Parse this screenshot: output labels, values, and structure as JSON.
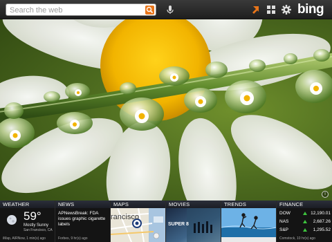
{
  "search": {
    "placeholder": "Search the web"
  },
  "toolbar": {
    "mic_icon": "microphone-icon",
    "location_icon": "location-arrow-icon",
    "grid_icon": "grid-icon",
    "settings_icon": "gear-icon",
    "logo": "bing"
  },
  "colors": {
    "accent": "#e8751a",
    "tile_bg": "#141414",
    "up": "#3ec43e"
  },
  "tiles": {
    "weather": {
      "header": "WEATHER",
      "temp": "59°",
      "condition": "Mostly Sunny",
      "location": "San Francisco, CA",
      "footer": "iMap, AIRNow, 1 min(s) ago",
      "icon": "moon-icon"
    },
    "news": {
      "header": "NEWS",
      "headline": "APNewsBreak: FDA issues graphic cigarette labels",
      "footer": "Forbes, 9 hr(s) ago"
    },
    "maps": {
      "header": "MAPS",
      "map_label": "rancisco"
    },
    "movies": {
      "header": "MOVIES",
      "poster_text": "SUPER 8"
    },
    "trends": {
      "header": "TRENDS"
    },
    "finance": {
      "header": "FINANCE",
      "rows": [
        {
          "name": "DOW",
          "value": "12,190.01"
        },
        {
          "name": "NAS",
          "value": "2,687.26"
        },
        {
          "name": "S&P",
          "value": "1,295.52"
        }
      ],
      "footer": "Comstock, 10 hr(s) ago"
    }
  }
}
